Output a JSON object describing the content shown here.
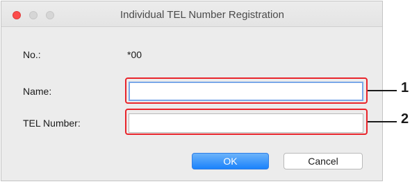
{
  "window": {
    "title": "Individual TEL Number Registration"
  },
  "form": {
    "number_label": "No.:",
    "number_value": "*00",
    "name_label": "Name:",
    "name_value": "",
    "tel_label": "TEL Number:",
    "tel_value": ""
  },
  "buttons": {
    "ok_label": "OK",
    "cancel_label": "Cancel"
  },
  "callouts": [
    "1",
    "2"
  ],
  "colors": {
    "callout_border": "#e9242a",
    "focus_ring": "#79a7e8",
    "default_button": "#1a82fb",
    "close_button": "#fc4c4b"
  }
}
